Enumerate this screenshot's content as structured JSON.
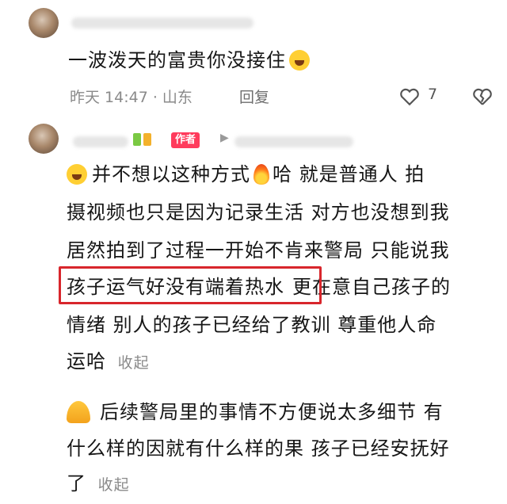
{
  "comment1": {
    "text": "一波泼天的富贵你没接住",
    "emoji": "crying-laughing-emoji",
    "time_location": "昨天 14:47 · 山东",
    "reply_label": "回复",
    "like_count": "7"
  },
  "reply1": {
    "author_badge": "作者",
    "line1_a": "并不想以这种方式",
    "line1_b": "哈 就是普通人 拍",
    "line2": "摄视频也只是因为记录生活 对方也没想到我",
    "line3": "居然拍到了过程一开始不肯来警局 只能说我",
    "line4_highlight": "孩子运气好没有端着热水",
    "line4_rest": "更在意自己孩子的",
    "line5": "情绪 别人的孩子已经给了教训 尊重他人命",
    "line6": "运哈",
    "collapse_label": "收起"
  },
  "reply2": {
    "line1": "后续警局里的事情不方便说太多细节 有",
    "line2": "什么样的因就有什么样的果 孩子已经安抚好",
    "line3": "了",
    "collapse_label": "收起"
  },
  "colors": {
    "accent": "#ff3b5c",
    "highlight_border": "#d8262c",
    "meta_gray": "#8a8a8a"
  }
}
